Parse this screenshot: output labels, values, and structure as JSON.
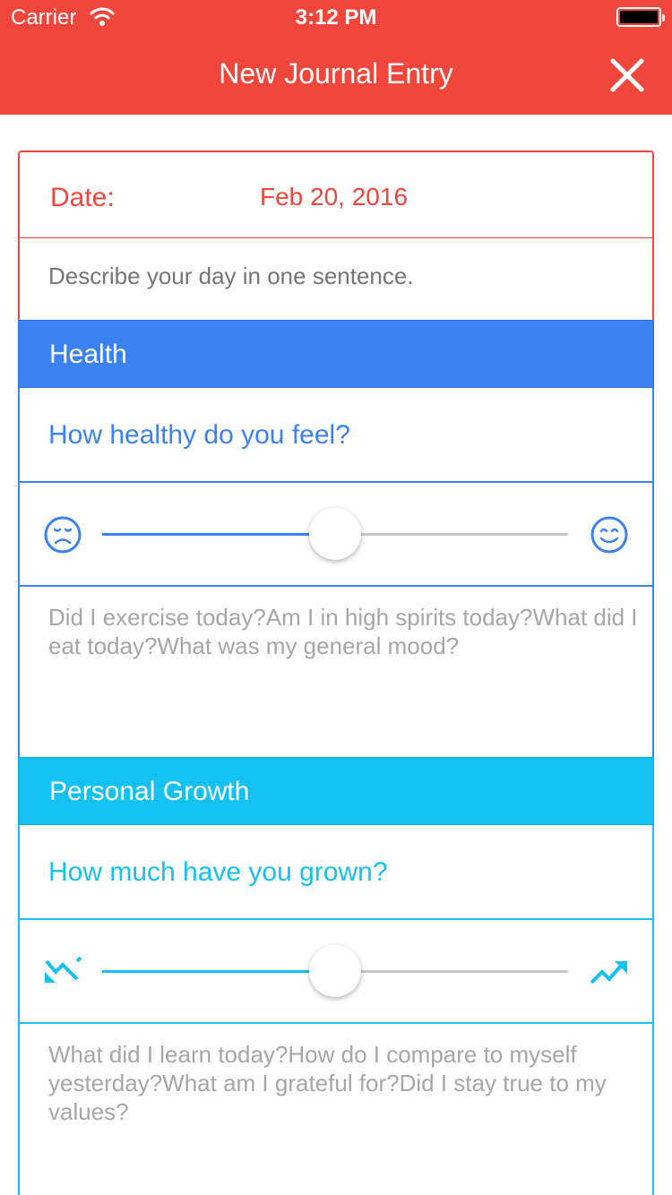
{
  "status_bar": {
    "carrier": "Carrier",
    "time": "3:12 PM"
  },
  "header": {
    "title": "New Journal Entry",
    "close_icon": "close-icon"
  },
  "colors": {
    "header": "#f0463c",
    "health": "#3b82f0",
    "growth": "#14c1f0"
  },
  "entry": {
    "date_label": "Date:",
    "date_value": "Feb 20, 2016",
    "sentence_placeholder": "Describe your day in one sentence."
  },
  "health": {
    "title": "Health",
    "question": "How healthy do you feel?",
    "slider": {
      "min_icon": "sad-face-icon",
      "max_icon": "happy-face-icon",
      "value_percent": 50
    },
    "notes_placeholder": "Did I exercise today?Am I in high spirits today?What did I eat today?What was my general mood?"
  },
  "growth": {
    "title": "Personal Growth",
    "question": "How much have you grown?",
    "slider": {
      "min_icon": "trend-down-icon",
      "max_icon": "trend-up-icon",
      "value_percent": 50
    },
    "notes_placeholder": "What did I learn today?How do I compare to myself yesterday?What am I grateful for?Did I stay true to my values?"
  }
}
